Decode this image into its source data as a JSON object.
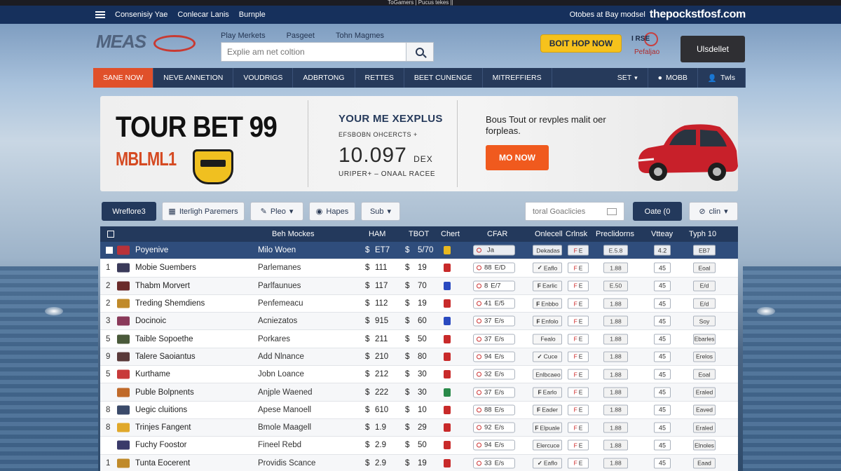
{
  "top_strip": "ToGamers | Pucus tekes ||",
  "topbar": {
    "links": [
      "Consenisiy Yae",
      "Conlecar Lanis",
      "Burnple"
    ],
    "tagline": "Otobes at Bay modsel",
    "domain": "thepockstfosf.com"
  },
  "header": {
    "logo_text": "MEAS",
    "links": [
      "Play Merkets",
      "Pasgeet",
      "Tohn Magmes"
    ],
    "search_placeholder": "Explie am net coltion",
    "cta_yellow": "BOIT HOP NOW",
    "brand_mini_top": "I RSE",
    "brand_mini_bottom": "Pefaljao",
    "dark_button": "Ulsdellet"
  },
  "catnav": {
    "items": [
      "SANE NOW",
      "NEVE ANNETION",
      "VOUDRIGS",
      "ADBRTONG",
      "RETTES",
      "BEET CUNENGE",
      "MITREFFIERS"
    ],
    "right": [
      "SET",
      "MOBB",
      "Twls"
    ]
  },
  "hero": {
    "title": "TOUR BET 99",
    "subtitle": "MBLML1",
    "mid_title": "YOUR ME XEXPLUS",
    "mid_small": "EFSBOBN   OHCERCTS   +",
    "mid_big": "10.097",
    "mid_big_suffix": "DEX",
    "mid_foot": "URIPER+ – ONAAL  RACEE",
    "right_text": "Bous Tout or revples malit oer forpleas.",
    "cta": "MO NOW"
  },
  "filters": {
    "buttons": [
      "Wreflore3",
      "Iterligh Paremers",
      "Pleo",
      "Hapes",
      "Sub"
    ],
    "search_placeholder": "toral Goaclicies",
    "btn_dark": "Oate (0",
    "btn_last": "clin"
  },
  "table": {
    "headers": [
      "Beh Mockes",
      "HAM",
      "TBOT",
      "Chert",
      "CFAR",
      "Onlecell",
      "Crlnsk",
      "Preclidorns",
      "Vtteay",
      "Typh 10"
    ],
    "rows": [
      {
        "num": "",
        "name": "Poyenive",
        "type": "Milo Woen",
        "v1": "ET7",
        "v2": "5/70",
        "chip": "#e8b820",
        "flag": "#b8323a",
        "sel_mark": "",
        "sel_a": "",
        "sel_b": "Ja",
        "p1": "Dekadas",
        "p2": "E",
        "p3": "E.5.8",
        "p4": "4.2",
        "p5": "EB7",
        "p1_mark": "",
        "p2_mark": "F"
      },
      {
        "num": "1",
        "name": "Mobie Suembers",
        "type": "Parlemanes",
        "v1": "111",
        "v2": "19",
        "chip": "#c82a2a",
        "flag": "#3a3a5a",
        "sel_mark": "",
        "sel_a": "88",
        "sel_b": "E/D",
        "p1": "Eaflo",
        "p2": "E",
        "p3": "1.88",
        "p4": "45",
        "p5": "Eoal",
        "p1_mark": "✓",
        "p2_mark": "F"
      },
      {
        "num": "2",
        "name": "Thabm Morvert",
        "type": "Parlfaunues",
        "v1": "117",
        "v2": "70",
        "chip": "#2a4ac0",
        "flag": "#6a2a2a",
        "sel_mark": "",
        "sel_a": "8",
        "sel_b": "E/7",
        "p1": "Earlic",
        "p2": "E",
        "p3": "E.50",
        "p4": "45",
        "p5": "E/d",
        "p1_mark": "F",
        "p2_mark": "F"
      },
      {
        "num": "2",
        "name": "Treding Shemdiens",
        "type": "Penfemeacu",
        "v1": "112",
        "v2": "19",
        "chip": "#c82a2a",
        "flag": "#c08a2a",
        "sel_mark": "",
        "sel_a": "41",
        "sel_b": "E/5",
        "p1": "Enbbo",
        "p2": "E",
        "p3": "1.88",
        "p4": "45",
        "p5": "E/d",
        "p1_mark": "F",
        "p2_mark": "F"
      },
      {
        "num": "3",
        "name": "Docinoic",
        "type": "Acniezatos",
        "v1": "915",
        "v2": "60",
        "chip": "#2a4ac0",
        "flag": "#8a3a5a",
        "sel_mark": "",
        "sel_a": "37",
        "sel_b": "E/s",
        "p1": "Enfolo",
        "p2": "E",
        "p3": "1.88",
        "p4": "45",
        "p5": "Soy",
        "p1_mark": "F",
        "p2_mark": "F"
      },
      {
        "num": "5",
        "name": "Taible Sopoethe",
        "type": "Porkares",
        "v1": "211",
        "v2": "50",
        "chip": "#c82a2a",
        "flag": "#4a5a3a",
        "sel_mark": "",
        "sel_a": "37",
        "sel_b": "E/s",
        "p1": "Fealo",
        "p2": "E",
        "p3": "1.88",
        "p4": "45",
        "p5": "Ebarles",
        "p1_mark": "",
        "p2_mark": "F"
      },
      {
        "num": "9",
        "name": "Talere Saoiantus",
        "type": "Add Nlnance",
        "v1": "210",
        "v2": "80",
        "chip": "#c82a2a",
        "flag": "#5a3a3a",
        "sel_mark": "",
        "sel_a": "94",
        "sel_b": "E/s",
        "p1": "Cuce",
        "p2": "E",
        "p3": "1.88",
        "p4": "45",
        "p5": "Erelos",
        "p1_mark": "✓",
        "p2_mark": "F"
      },
      {
        "num": "5",
        "name": "Kurthame",
        "type": "Jobn Loance",
        "v1": "212",
        "v2": "30",
        "chip": "#c82a2a",
        "flag": "#c83a3a",
        "sel_mark": "",
        "sel_a": "32",
        "sel_b": "E/s",
        "p1": "Enlbcaeo",
        "p2": "E",
        "p3": "1.88",
        "p4": "45",
        "p5": "Eoal",
        "p1_mark": "",
        "p2_mark": "F"
      },
      {
        "num": "",
        "name": "Puble Bolpnents",
        "type": "Anjple Waened",
        "v1": "222",
        "v2": "30",
        "chip": "#2a8a4a",
        "flag": "#c06a2a",
        "sel_mark": "",
        "sel_a": "37",
        "sel_b": "E/s",
        "p1": "Earlo",
        "p2": "E",
        "p3": "1.88",
        "p4": "45",
        "p5": "Eraled",
        "p1_mark": "F",
        "p2_mark": "F"
      },
      {
        "num": "8",
        "name": "Uegic cluitions",
        "type": "Apese Manoell",
        "v1": "610",
        "v2": "10",
        "chip": "#c82a2a",
        "flag": "#3a4a6a",
        "sel_mark": "",
        "sel_a": "88",
        "sel_b": "E/s",
        "p1": "Eader",
        "p2": "E",
        "p3": "1.88",
        "p4": "45",
        "p5": "Eaved",
        "p1_mark": "F",
        "p2_mark": "F"
      },
      {
        "num": "8",
        "name": "Trinjes Fangent",
        "type": "Bmole Maagell",
        "v1": "1.9",
        "v2": "29",
        "chip": "#c82a2a",
        "flag": "#e0a82a",
        "sel_mark": "",
        "sel_a": "92",
        "sel_b": "E/s",
        "p1": "Elpuale",
        "p2": "E",
        "p3": "1.88",
        "p4": "45",
        "p5": "Eraled",
        "p1_mark": "F",
        "p2_mark": "F"
      },
      {
        "num": "",
        "name": "Fuchy Foostor",
        "type": "Fineel Rebd",
        "v1": "2.9",
        "v2": "50",
        "chip": "#c82a2a",
        "flag": "#3a3a6a",
        "sel_mark": "",
        "sel_a": "94",
        "sel_b": "E/s",
        "p1": "Elercuce",
        "p2": "E",
        "p3": "1.88",
        "p4": "45",
        "p5": "Elnoles",
        "p1_mark": "",
        "p2_mark": "F"
      },
      {
        "num": "1",
        "name": "Tunta Eocerent",
        "type": "Providis Scance",
        "v1": "2.9",
        "v2": "19",
        "chip": "#c82a2a",
        "flag": "#c08a2a",
        "sel_mark": "",
        "sel_a": "33",
        "sel_b": "E/s",
        "p1": "Eaflo",
        "p2": "E",
        "p3": "1.88",
        "p4": "45",
        "p5": "Eaad",
        "p1_mark": "✓",
        "p2_mark": "F"
      }
    ]
  }
}
